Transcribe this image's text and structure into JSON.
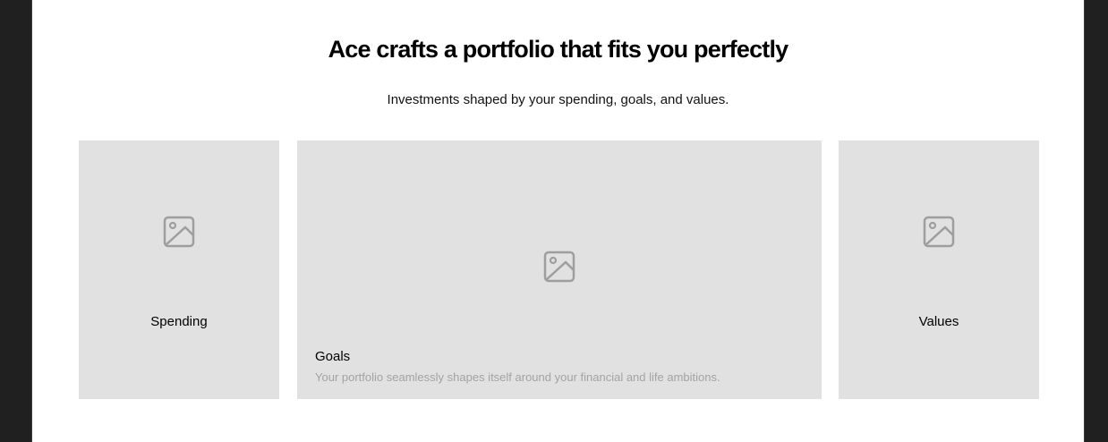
{
  "section": {
    "headline": "Ace crafts a portfolio that fits you perfectly",
    "subheadline": "Investments shaped by your spending, goals, and values."
  },
  "cards": {
    "spending": {
      "label": "Spending",
      "icon": "image-placeholder-icon"
    },
    "goals": {
      "label": "Goals",
      "description": "Your portfolio seamlessly shapes itself around your financial and life ambitions.",
      "icon": "image-placeholder-icon"
    },
    "values": {
      "label": "Values",
      "icon": "image-placeholder-icon"
    }
  },
  "colors": {
    "frame": "#202020",
    "card_background": "#e1e1e1",
    "icon": "#9e9e9e",
    "muted_text": "#a3a3a3"
  }
}
